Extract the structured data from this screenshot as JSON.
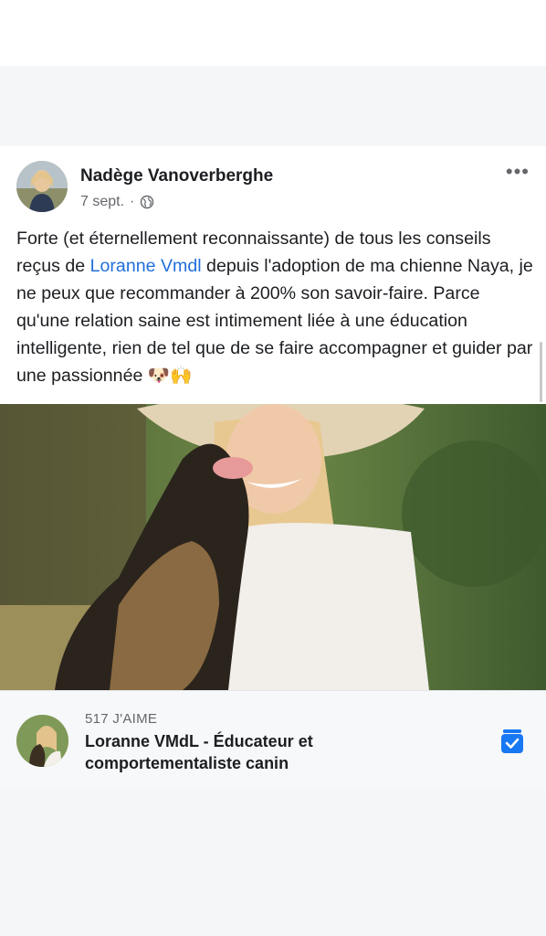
{
  "post": {
    "author": "Nadège Vanoverberghe",
    "date": "7 sept.",
    "separator": "·",
    "more_label": "•••",
    "text_segments": {
      "before": "Forte (et éternellement reconnaissante) de tous les conseils reçus de ",
      "mention": "Loranne Vmdl",
      "after": " depuis l'adoption de ma chienne Naya, je ne peux que recommander à 200% son savoir-faire. Parce qu'une relation saine est intimement liée à une éducation intelligente, rien de tel que de se faire accompagner et guider par une passionnée 🐶🙌"
    }
  },
  "page": {
    "likes": "517 J'AIME",
    "name": "Loranne VMdL - Éducateur et comportementaliste canin"
  },
  "colors": {
    "accent": "#216fdb",
    "save_icon": "#1877f2"
  }
}
